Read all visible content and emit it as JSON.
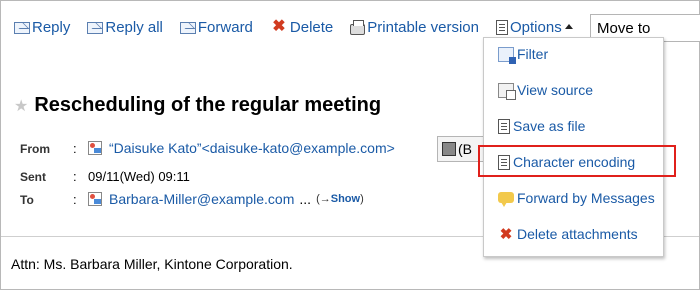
{
  "toolbar": {
    "reply": "Reply",
    "reply_all": "Reply all",
    "forward": "Forward",
    "delete": "Delete",
    "printable": "Printable version",
    "options": "Options",
    "move_to": "Move to"
  },
  "message": {
    "title": "Rescheduling of the regular meeting",
    "from_label": "From",
    "from_value": "“Daisuke Kato”<daisuke-kato@example.com>",
    "address_button": "(B",
    "sent_label": "Sent",
    "sent_value": "09/11(Wed) 09:11",
    "to_label": "To",
    "to_value": "Barbara-Miller@example.com",
    "to_more": "...",
    "show_prefix": "(→",
    "show_link": "Show",
    "show_suffix": ")",
    "body": "Attn: Ms. Barbara Miller, Kintone Corporation."
  },
  "options_menu": {
    "items": [
      {
        "label": "Filter",
        "icon": "filter-icon"
      },
      {
        "label": "View source",
        "icon": "view-source-icon"
      },
      {
        "label": "Save as file",
        "icon": "save-file-icon"
      },
      {
        "label": "Character encoding",
        "icon": "character-encoding-icon"
      },
      {
        "label": "Forward by Messages",
        "icon": "message-bubble-icon"
      },
      {
        "label": "Delete attachments",
        "icon": "delete-x-icon"
      }
    ],
    "highlighted": "Character encoding"
  },
  "colors": {
    "link": "#1a5aa6",
    "delete": "#d13b20",
    "highlight": "#e0201b"
  }
}
